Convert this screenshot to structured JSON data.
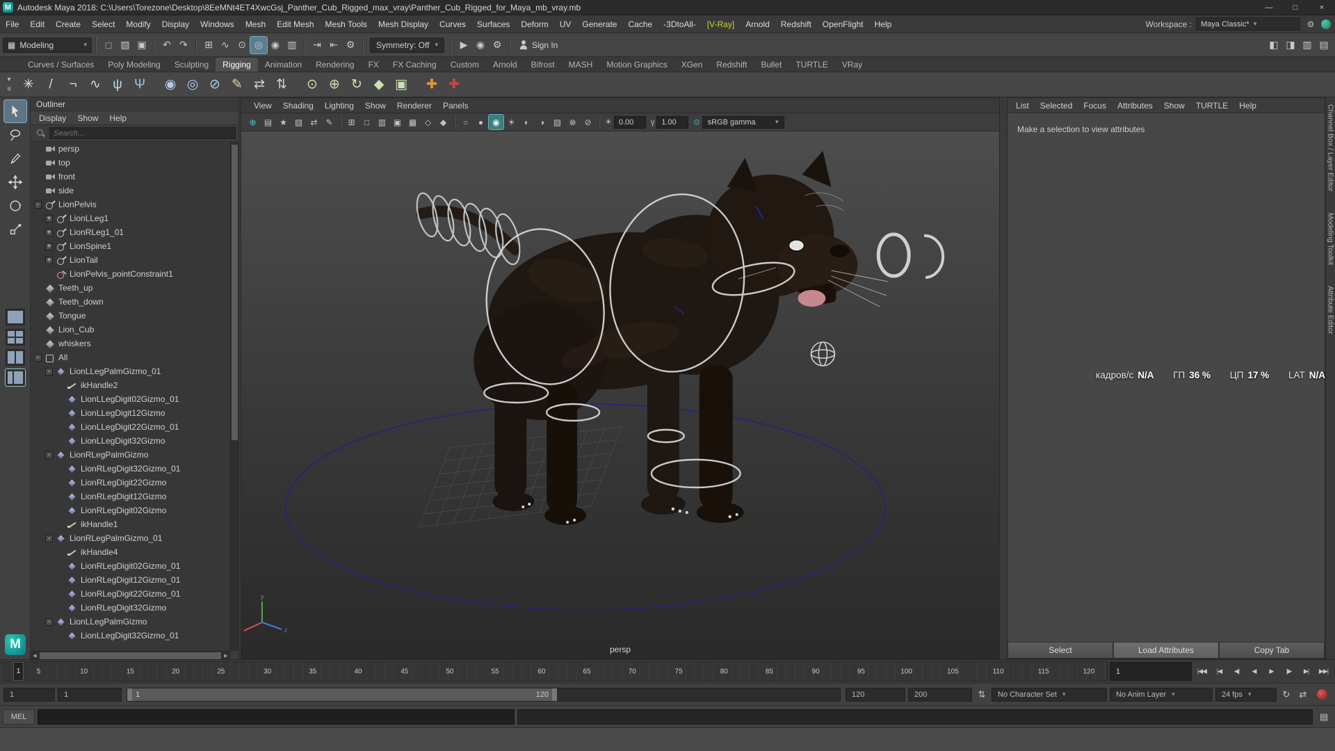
{
  "window": {
    "logo_text": "M",
    "title": "Autodesk Maya 2018: C:\\Users\\Torezone\\Desktop\\8EeMNt4ET4XwcGsj_Panther_Cub_Rigged_max_vray\\Panther_Cub_Rigged_for_Maya_mb_vray.mb",
    "minimize": "—",
    "maximize": "□",
    "close": "×"
  },
  "menubar": {
    "items": [
      {
        "label": "File"
      },
      {
        "label": "Edit"
      },
      {
        "label": "Create"
      },
      {
        "label": "Select"
      },
      {
        "label": "Modify"
      },
      {
        "label": "Display"
      },
      {
        "label": "Windows"
      },
      {
        "label": "Mesh"
      },
      {
        "label": "Edit Mesh"
      },
      {
        "label": "Mesh Tools"
      },
      {
        "label": "Mesh Display"
      },
      {
        "label": "Curves"
      },
      {
        "label": "Surfaces"
      },
      {
        "label": "Deform"
      },
      {
        "label": "UV"
      },
      {
        "label": "Generate"
      },
      {
        "label": "Cache"
      },
      {
        "label": "-3DtoAll-"
      },
      {
        "label": "[V-Ray]",
        "color": "#c9d42e"
      },
      {
        "label": "Arnold"
      },
      {
        "label": "Redshift"
      },
      {
        "label": "OpenFlight"
      },
      {
        "label": "Help"
      }
    ],
    "workspace_label": "Workspace :",
    "workspace_value": "Maya Classic*"
  },
  "statusline": {
    "mode": "Modeling",
    "mode_icon": "▦",
    "symmetry": "Symmetry: Off",
    "sign_in": "Sign In",
    "icons": [
      {
        "n": "new-scene-icon",
        "g": "□"
      },
      {
        "n": "open-scene-icon",
        "g": "▧"
      },
      {
        "n": "save-scene-icon",
        "g": "▣"
      },
      {
        "t": "divider"
      },
      {
        "n": "undo-icon",
        "g": "↶"
      },
      {
        "n": "redo-icon",
        "g": "↷"
      },
      {
        "t": "divider"
      },
      {
        "n": "snap-to-grid-icon",
        "g": "⊞"
      },
      {
        "n": "snap-to-curve-icon",
        "g": "∿"
      },
      {
        "n": "snap-to-point-icon",
        "g": "⊙"
      },
      {
        "n": "snap-to-projected-center-icon",
        "g": "◎",
        "active": true
      },
      {
        "n": "make-live-icon",
        "g": "◉"
      },
      {
        "n": "snap-to-view-plane-icon",
        "g": "▥"
      },
      {
        "t": "divider"
      },
      {
        "n": "input-connections-icon",
        "g": "⇥"
      },
      {
        "n": "output-connections-icon",
        "g": "⇤"
      },
      {
        "n": "construction-history-icon",
        "g": "⚙"
      }
    ],
    "render_icons": [
      {
        "n": "render-current-frame-icon",
        "g": "▶"
      },
      {
        "n": "ipr-render-icon",
        "g": "◉"
      },
      {
        "n": "render-settings-icon",
        "g": "⚙"
      }
    ],
    "sidebar_toggles": [
      {
        "n": "attribute-editor-toggle-icon",
        "g": "◧"
      },
      {
        "n": "tool-settings-toggle-icon",
        "g": "◨"
      },
      {
        "n": "channel-box-toggle-icon",
        "g": "▥"
      },
      {
        "n": "workspace-panel-toggle-icon",
        "g": "▤"
      }
    ]
  },
  "shelf": {
    "side_icons": [
      {
        "n": "shelf-selector-icon",
        "g": "▾"
      },
      {
        "n": "shelf-menu-icon",
        "g": "≡"
      }
    ],
    "tabs": [
      {
        "label": "Curves / Surfaces"
      },
      {
        "label": "Poly Modeling"
      },
      {
        "label": "Sculpting"
      },
      {
        "label": "Rigging",
        "active": true
      },
      {
        "label": "Animation"
      },
      {
        "label": "Rendering"
      },
      {
        "label": "FX"
      },
      {
        "label": "FX Caching"
      },
      {
        "label": "Custom"
      },
      {
        "label": "Arnold"
      },
      {
        "label": "Bifrost"
      },
      {
        "label": "MASH"
      },
      {
        "label": "Motion Graphics"
      },
      {
        "label": "XGen"
      },
      {
        "label": "Redshift"
      },
      {
        "label": "Bullet"
      },
      {
        "label": "TURTLE"
      },
      {
        "label": "VRay"
      }
    ],
    "icons": [
      {
        "n": "joint-tool-icon",
        "g": "✳",
        "color": "#ececec"
      },
      {
        "n": "create-joints-icon",
        "g": "/",
        "color": "#d8d8d8"
      },
      {
        "n": "ik-handle-icon",
        "g": "¬",
        "color": "#d8d8d8"
      },
      {
        "n": "ik-spline-icon",
        "g": "∿",
        "color": "#d8d8d8"
      },
      {
        "n": "humanik-character-icon",
        "g": "ψ",
        "color": "#b7d9ea"
      },
      {
        "n": "quick-rig-icon",
        "g": "Ψ",
        "color": "#8fc7e0"
      },
      {
        "t": "divider"
      },
      {
        "n": "bind-skin-icon",
        "g": "◉",
        "color": "#aecbe8"
      },
      {
        "n": "interactive-bind-icon",
        "g": "◎",
        "color": "#aecbe8"
      },
      {
        "n": "detach-skin-icon",
        "g": "⊘",
        "color": "#aecbe8"
      },
      {
        "n": "paint-skin-weights-icon",
        "g": "✎",
        "color": "#e8d0ae"
      },
      {
        "n": "mirror-skin-weights-icon",
        "g": "⇄",
        "color": "#cfcfcf"
      },
      {
        "n": "copy-skin-weights-icon",
        "g": "⇅",
        "color": "#cfcfcf"
      },
      {
        "t": "divider"
      },
      {
        "n": "point-constraint-icon",
        "g": "⊙",
        "color": "#cfe0b0"
      },
      {
        "n": "aim-constraint-icon",
        "g": "⊕",
        "color": "#cfe0b0"
      },
      {
        "n": "orient-constraint-icon",
        "g": "↻",
        "color": "#cfe0b0"
      },
      {
        "n": "parent-constraint-icon",
        "g": "◆",
        "color": "#cfe0b0"
      },
      {
        "n": "scale-constraint-icon",
        "g": "▣",
        "color": "#cfe0b0"
      },
      {
        "t": "divider"
      },
      {
        "n": "add-influence-icon",
        "g": "✚",
        "color": "#e69138"
      },
      {
        "n": "remove-influence-icon",
        "g": "✚",
        "color": "#cc4444"
      }
    ]
  },
  "outliner": {
    "panel_title": "Outliner",
    "menus": [
      {
        "label": "Display"
      },
      {
        "label": "Show"
      },
      {
        "label": "Help"
      }
    ],
    "search_placeholder": "Search...",
    "tree": [
      {
        "label": "persp",
        "depth": 1,
        "t": "camera"
      },
      {
        "label": "top",
        "depth": 1,
        "t": "camera"
      },
      {
        "label": "front",
        "depth": 1,
        "t": "camera"
      },
      {
        "label": "side",
        "depth": 1,
        "t": "camera"
      },
      {
        "label": "LionPelvis",
        "depth": 1,
        "t": "joint",
        "exp": "-"
      },
      {
        "label": "LionLLeg1",
        "depth": 2,
        "t": "joint",
        "exp": "+"
      },
      {
        "label": "LionRLeg1_01",
        "depth": 2,
        "t": "joint",
        "exp": "+"
      },
      {
        "label": "LionSpine1",
        "depth": 2,
        "t": "joint",
        "exp": "+"
      },
      {
        "label": "LionTail",
        "depth": 2,
        "t": "joint",
        "exp": "+"
      },
      {
        "label": "LionPelvis_pointConstraint1",
        "depth": 2,
        "t": "constraint"
      },
      {
        "label": "Teeth_up",
        "depth": 1,
        "t": "mesh"
      },
      {
        "label": "Teeth_down",
        "depth": 1,
        "t": "mesh"
      },
      {
        "label": "Tongue",
        "depth": 1,
        "t": "mesh"
      },
      {
        "label": "Lion_Cub",
        "depth": 1,
        "t": "mesh"
      },
      {
        "label": "whiskers",
        "depth": 1,
        "t": "mesh"
      },
      {
        "label": "All",
        "depth": 1,
        "t": "group",
        "exp": "-"
      },
      {
        "label": "LionLLegPalmGizmo_01",
        "depth": 2,
        "t": "gizmo",
        "exp": "-"
      },
      {
        "label": "ikHandle2",
        "depth": 3,
        "t": "ik"
      },
      {
        "label": "LionLLegDigit02Gizmo_01",
        "depth": 3,
        "t": "gizmo"
      },
      {
        "label": "LionLLegDigit12Gizmo",
        "depth": 3,
        "t": "gizmo"
      },
      {
        "label": "LionLLegDigit22Gizmo_01",
        "depth": 3,
        "t": "gizmo"
      },
      {
        "label": "LionLLegDigit32Gizmo",
        "depth": 3,
        "t": "gizmo"
      },
      {
        "label": "LionRLegPalmGizmo",
        "depth": 2,
        "t": "gizmo",
        "exp": "-"
      },
      {
        "label": "LionRLegDigit32Gizmo_01",
        "depth": 3,
        "t": "gizmo"
      },
      {
        "label": "LionRLegDigit22Gizmo",
        "depth": 3,
        "t": "gizmo"
      },
      {
        "label": "LionRLegDigit12Gizmo",
        "depth": 3,
        "t": "gizmo"
      },
      {
        "label": "LionRLegDigit02Gizmo",
        "depth": 3,
        "t": "gizmo"
      },
      {
        "label": "ikHandle1",
        "depth": 3,
        "t": "ik"
      },
      {
        "label": "LionRLegPalmGizmo_01",
        "depth": 2,
        "t": "gizmo",
        "exp": "-"
      },
      {
        "label": "ikHandle4",
        "depth": 3,
        "t": "ik"
      },
      {
        "label": "LionRLegDigit02Gizmo_01",
        "depth": 3,
        "t": "gizmo"
      },
      {
        "label": "LionRLegDigit12Gizmo_01",
        "depth": 3,
        "t": "gizmo"
      },
      {
        "label": "LionRLegDigit22Gizmo_01",
        "depth": 3,
        "t": "gizmo"
      },
      {
        "label": "LionRLegDigit32Gizmo",
        "depth": 3,
        "t": "gizmo"
      },
      {
        "label": "LionLLegPalmGizmo",
        "depth": 2,
        "t": "gizmo",
        "exp": "-"
      },
      {
        "label": "LionLLegDigit32Gizmo_01",
        "depth": 3,
        "t": "gizmo"
      }
    ]
  },
  "viewport": {
    "menus": [
      {
        "label": "View"
      },
      {
        "label": "Shading"
      },
      {
        "label": "Lighting"
      },
      {
        "label": "Show"
      },
      {
        "label": "Renderer"
      },
      {
        "label": "Panels"
      }
    ],
    "toolbar_icons": [
      {
        "n": "select-camera-icon",
        "g": "⊕",
        "color": "#49c4c8"
      },
      {
        "n": "camera-attributes-icon",
        "g": "▤"
      },
      {
        "n": "bookmarks-icon",
        "g": "★"
      },
      {
        "n": "image-plane-icon",
        "g": "▧"
      },
      {
        "n": "two-d-pan-zoom-icon",
        "g": "⇄"
      },
      {
        "n": "grease-pencil-icon",
        "g": "✎"
      },
      {
        "t": "divider"
      },
      {
        "n": "grid-icon",
        "g": "⊞"
      },
      {
        "n": "film-gate-icon",
        "g": "□"
      },
      {
        "n": "resolution-gate-icon",
        "g": "▥"
      },
      {
        "n": "gate-mask-icon",
        "g": "▣"
      },
      {
        "n": "field-chart-icon",
        "g": "▦"
      },
      {
        "n": "safe-action-icon",
        "g": "◇"
      },
      {
        "n": "safe-title-icon",
        "g": "◆"
      },
      {
        "t": "divider"
      },
      {
        "n": "wireframe-icon",
        "g": "○"
      },
      {
        "n": "shaded-icon",
        "g": "●"
      },
      {
        "n": "textured-icon",
        "g": "◉",
        "active": true
      },
      {
        "n": "use-all-lights-icon",
        "g": "☀"
      },
      {
        "n": "shadows-icon",
        "g": "◐"
      },
      {
        "n": "screen-space-ao-icon",
        "g": "◑"
      },
      {
        "n": "anti-aliasing-icon",
        "g": "▨"
      },
      {
        "n": "xray-icon",
        "g": "⊗"
      },
      {
        "n": "isolate-select-icon",
        "g": "⊘"
      },
      {
        "t": "divider"
      }
    ],
    "exposure_icon": "☀",
    "exposure_value": "0.00",
    "gamma_icon": "γ",
    "gamma_value": "1.00",
    "view_transform_icon": "⊙",
    "colorspace": "sRGB gamma",
    "camera_label": "persp"
  },
  "attribute_editor": {
    "menus": [
      {
        "label": "List"
      },
      {
        "label": "Selected"
      },
      {
        "label": "Focus"
      },
      {
        "label": "Attributes"
      },
      {
        "label": "Show"
      },
      {
        "label": "TURTLE"
      },
      {
        "label": "Help"
      }
    ],
    "empty_message": "Make a selection to view attributes",
    "buttons": [
      {
        "label": "Select"
      },
      {
        "label": "Load Attributes",
        "active": true
      },
      {
        "label": "Copy Tab"
      }
    ]
  },
  "side_tabs": {
    "items": [
      {
        "label": "Channel Box / Layer Editor"
      },
      {
        "label": "Modeling Toolkit"
      },
      {
        "label": "Attribute Editor"
      }
    ]
  },
  "stats": {
    "fps_label": "кадров/с",
    "fps_value": "N/A",
    "gpu_label": "ГП",
    "gpu_value": "36 %",
    "cpu_label": "ЦП",
    "cpu_value": "17 %",
    "lat_label": "LAT",
    "lat_value": "N/A"
  },
  "timeline": {
    "current_frame_marker": "1",
    "current_time": "1",
    "ticks": [
      {
        "label": "5",
        "x": "3.3%"
      },
      {
        "label": "10",
        "x": "7.4%"
      },
      {
        "label": "15",
        "x": "11.6%"
      },
      {
        "label": "20",
        "x": "15.7%"
      },
      {
        "label": "25",
        "x": "19.8%"
      },
      {
        "label": "30",
        "x": "24%"
      },
      {
        "label": "35",
        "x": "28.1%"
      },
      {
        "label": "40",
        "x": "32.2%"
      },
      {
        "label": "45",
        "x": "36.4%"
      },
      {
        "label": "50",
        "x": "40.5%"
      },
      {
        "label": "55",
        "x": "44.6%"
      },
      {
        "label": "60",
        "x": "48.8%"
      },
      {
        "label": "65",
        "x": "52.9%"
      },
      {
        "label": "70",
        "x": "57%"
      },
      {
        "label": "75",
        "x": "61.2%"
      },
      {
        "label": "80",
        "x": "65.3%"
      },
      {
        "label": "85",
        "x": "69.4%"
      },
      {
        "label": "90",
        "x": "73.6%"
      },
      {
        "label": "95",
        "x": "77.7%"
      },
      {
        "label": "100",
        "x": "81.8%"
      },
      {
        "label": "105",
        "x": "86%"
      },
      {
        "label": "110",
        "x": "90.1%"
      },
      {
        "label": "115",
        "x": "94.2%"
      },
      {
        "label": "120",
        "x": "98.3%"
      }
    ],
    "playback_buttons": [
      {
        "n": "go-to-start-button",
        "g": "|◀◀"
      },
      {
        "n": "step-back-frame-button",
        "g": "|◀"
      },
      {
        "n": "step-back-key-button",
        "g": "◀|"
      },
      {
        "n": "play-backwards-button",
        "g": "◀"
      },
      {
        "n": "play-forwards-button",
        "g": "▶"
      },
      {
        "n": "step-forward-key-button",
        "g": "|▶"
      },
      {
        "n": "step-forward-frame-button",
        "g": "▶|"
      },
      {
        "n": "go-to-end-button",
        "g": "▶▶|"
      }
    ]
  },
  "rangeslider": {
    "animation_start": "1",
    "playback_start": "1",
    "bar_start_label": "1",
    "bar_end_label": "120",
    "playback_end": "120",
    "animation_end": "200",
    "spinner_glyph": "⇅",
    "character_set": "No Character Set",
    "anim_layer": "No Anim Layer",
    "fps": "24 fps",
    "icons": [
      {
        "n": "playback-options-icon",
        "g": "↻"
      },
      {
        "n": "playback-speed-icon",
        "g": "⇄"
      }
    ]
  },
  "commandline": {
    "mel_label": "MEL"
  }
}
